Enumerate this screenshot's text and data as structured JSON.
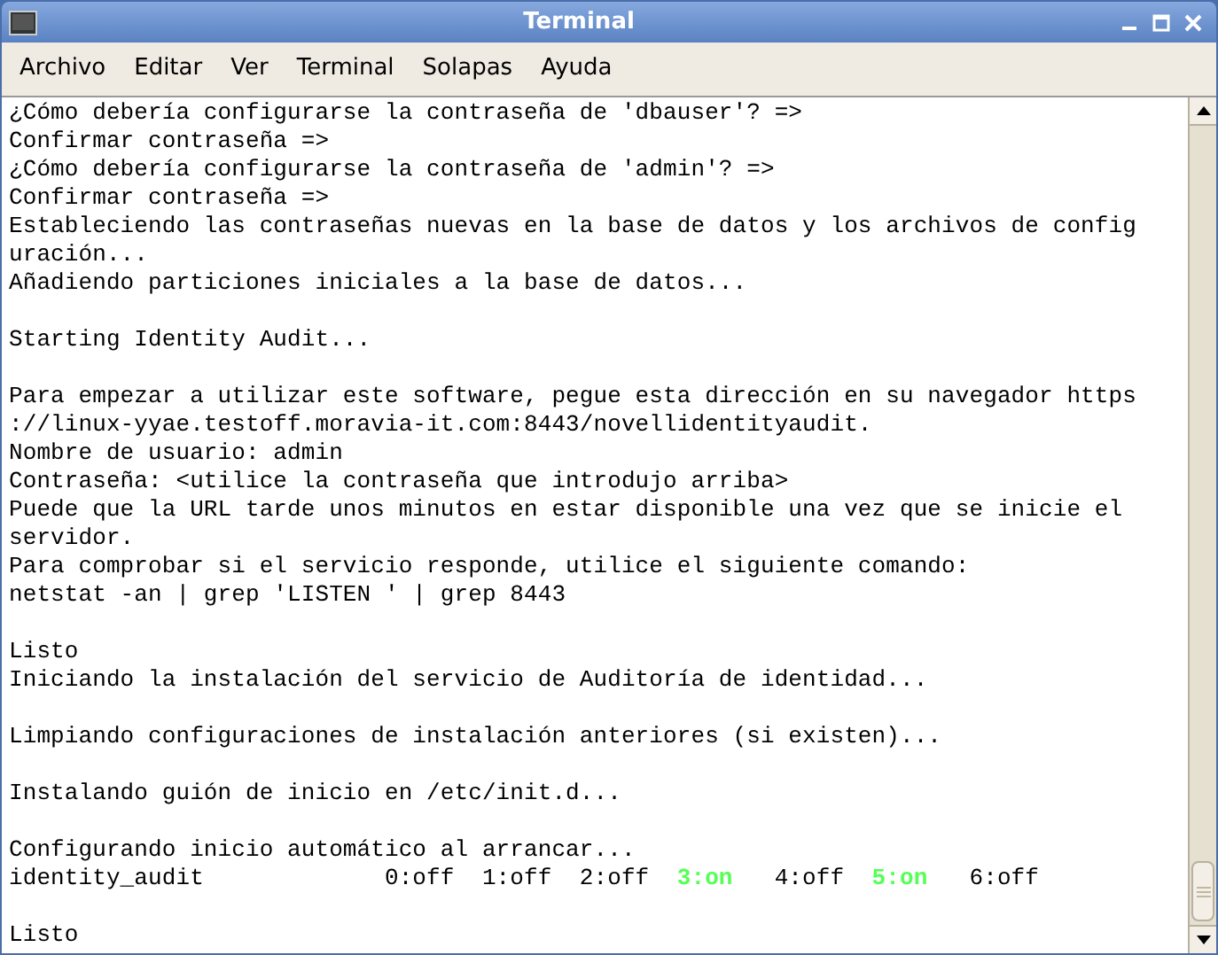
{
  "window": {
    "title": "Terminal"
  },
  "menu": [
    "Archivo",
    "Editar",
    "Ver",
    "Terminal",
    "Solapas",
    "Ayuda"
  ],
  "lines": [
    {
      "kind": "text",
      "segments": [
        {
          "text": "¿Cómo debería configurarse la contraseña de 'dbauser'? =>"
        }
      ]
    },
    {
      "kind": "text",
      "segments": [
        {
          "text": "Confirmar contraseña =>"
        }
      ]
    },
    {
      "kind": "text",
      "segments": [
        {
          "text": "¿Cómo debería configurarse la contraseña de 'admin'? =>"
        }
      ]
    },
    {
      "kind": "text",
      "segments": [
        {
          "text": "Confirmar contraseña =>"
        }
      ]
    },
    {
      "kind": "text",
      "segments": [
        {
          "text": "Estableciendo las contraseñas nuevas en la base de datos y los archivos de config"
        }
      ]
    },
    {
      "kind": "text",
      "segments": [
        {
          "text": "uración..."
        }
      ]
    },
    {
      "kind": "text",
      "segments": [
        {
          "text": "Añadiendo particiones iniciales a la base de datos..."
        }
      ]
    },
    {
      "kind": "blank"
    },
    {
      "kind": "text",
      "segments": [
        {
          "text": "Starting Identity Audit..."
        }
      ]
    },
    {
      "kind": "blank"
    },
    {
      "kind": "text",
      "segments": [
        {
          "text": "Para empezar a utilizar este software, pegue esta dirección en su navegador https"
        }
      ]
    },
    {
      "kind": "text",
      "segments": [
        {
          "text": "://linux-yyae.testoff.moravia-it.com:8443/novellidentityaudit."
        }
      ]
    },
    {
      "kind": "text",
      "segments": [
        {
          "text": "Nombre de usuario: admin"
        }
      ]
    },
    {
      "kind": "text",
      "segments": [
        {
          "text": "Contraseña: <utilice la contraseña que introdujo arriba>"
        }
      ]
    },
    {
      "kind": "text",
      "segments": [
        {
          "text": "Puede que la URL tarde unos minutos en estar disponible una vez que se inicie el"
        }
      ]
    },
    {
      "kind": "text",
      "segments": [
        {
          "text": "servidor."
        }
      ]
    },
    {
      "kind": "text",
      "segments": [
        {
          "text": "Para comprobar si el servicio responde, utilice el siguiente comando:"
        }
      ]
    },
    {
      "kind": "text",
      "segments": [
        {
          "text": "netstat -an | grep 'LISTEN ' | grep 8443"
        }
      ]
    },
    {
      "kind": "blank"
    },
    {
      "kind": "text",
      "segments": [
        {
          "text": "Listo"
        }
      ]
    },
    {
      "kind": "text",
      "segments": [
        {
          "text": "Iniciando la instalación del servicio de Auditoría de identidad..."
        }
      ]
    },
    {
      "kind": "blank"
    },
    {
      "kind": "text",
      "segments": [
        {
          "text": "Limpiando configuraciones de instalación anteriores (si existen)..."
        }
      ]
    },
    {
      "kind": "blank"
    },
    {
      "kind": "text",
      "segments": [
        {
          "text": "Instalando guión de inicio en /etc/init.d..."
        }
      ]
    },
    {
      "kind": "blank"
    },
    {
      "kind": "text",
      "segments": [
        {
          "text": "Configurando inicio automático al arrancar..."
        }
      ]
    },
    {
      "kind": "text",
      "segments": [
        {
          "text": "identity_audit             0:off  1:off  2:off  ",
          "color": "#000000"
        },
        {
          "text": "3:on",
          "color": "#55ff55"
        },
        {
          "text": "   4:off  ",
          "color": "#000000"
        },
        {
          "text": "5:on",
          "color": "#55ff55"
        },
        {
          "text": "   6:off",
          "color": "#000000"
        }
      ]
    },
    {
      "kind": "blank"
    },
    {
      "kind": "text",
      "segments": [
        {
          "text": "Listo"
        }
      ]
    }
  ]
}
